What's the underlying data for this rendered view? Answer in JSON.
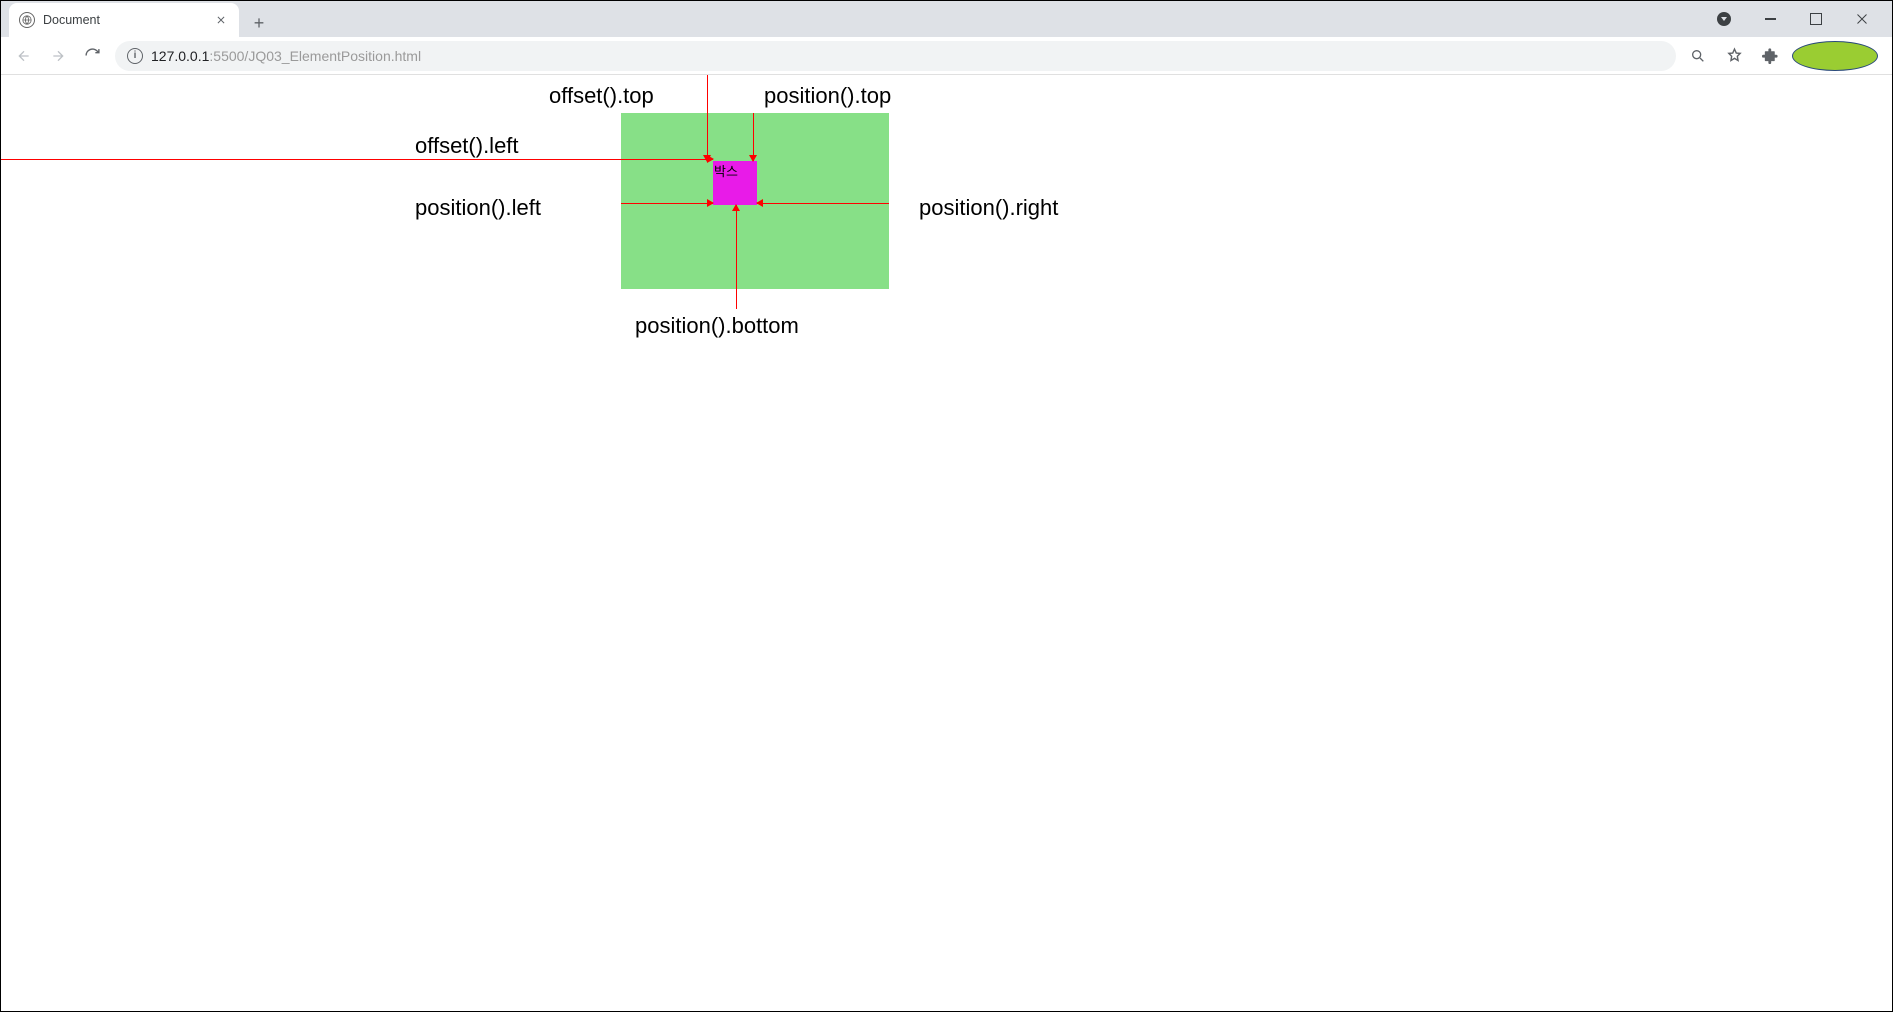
{
  "browser": {
    "tab": {
      "title": "Document"
    },
    "url_prefix": "127.0.0.1",
    "url_suffix": ":5500/JQ03_ElementPosition.html"
  },
  "diagram": {
    "inner_box_label": "박스",
    "labels": {
      "offset_top": "offset().top",
      "position_top": "position().top",
      "offset_left": "offset().left",
      "position_left": "position().left",
      "position_right": "position().right",
      "position_bottom": "position().bottom"
    }
  }
}
